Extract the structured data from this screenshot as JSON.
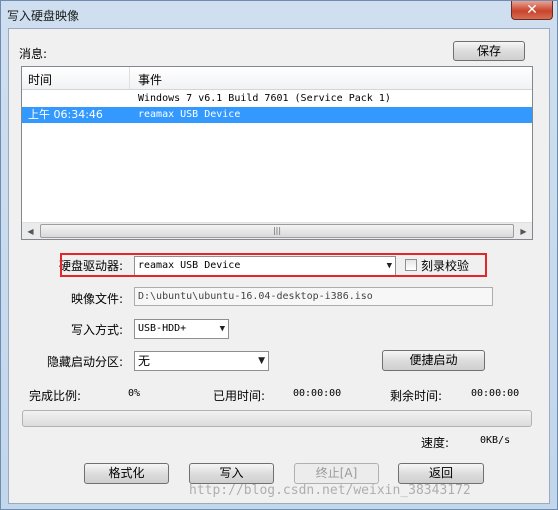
{
  "window": {
    "title": "写入硬盘映像",
    "close_label": "✕"
  },
  "messages": {
    "label": "消息:",
    "save_label": "保存",
    "columns": [
      "时间",
      "事件"
    ],
    "rows": [
      {
        "time": "",
        "event": "Windows 7 v6.1 Build 7601 (Service Pack 1)",
        "selected": false
      },
      {
        "time": "上午 06:34:46",
        "event": "reamax USB Device",
        "selected": true
      }
    ],
    "scroll_left": "◀",
    "scroll_right": "▶",
    "scroll_grip": "|||"
  },
  "form": {
    "drive_label": "硬盘驱动器:",
    "drive_value": "reamax USB Device",
    "verify_label": "刻录校验",
    "verify_checked": false,
    "image_label": "映像文件:",
    "image_value": "D:\\ubuntu\\ubuntu-16.04-desktop-i386.iso",
    "write_mode_label": "写入方式:",
    "write_mode_value": "USB-HDD+",
    "hidden_part_label": "隐藏启动分区:",
    "hidden_part_value": "无",
    "quick_boot_label": "便捷启动",
    "dropdown_arrow": "▼"
  },
  "progress": {
    "complete_label": "完成比例:",
    "complete_value": "0%",
    "elapsed_label": "已用时间:",
    "elapsed_value": "00:00:00",
    "remaining_label": "剩余时间:",
    "remaining_value": "00:00:00",
    "fraction": 0,
    "speed_label": "速度:",
    "speed_value": "0KB/s"
  },
  "actions": {
    "format_label": "格式化",
    "write_label": "写入",
    "stop_label": "终止[A]",
    "back_label": "返回"
  },
  "watermark": "http://blog.csdn.net/weixin_38343172"
}
